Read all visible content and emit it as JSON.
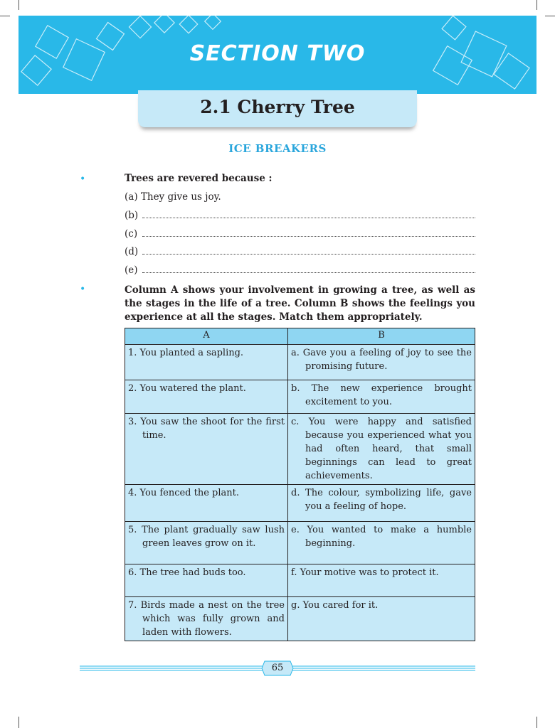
{
  "section_title": "SECTION TWO",
  "chapter_title": "2.1  Cherry  Tree",
  "subheading": "ICE  BREAKERS",
  "question1": {
    "text": "Trees  are  revered  because :",
    "options": [
      "(a)  They  give  us  joy.",
      "(b)",
      "(c)",
      "(d)",
      "(e)"
    ]
  },
  "question2": {
    "text": "Column A shows your involvement in growing a tree, as well as the stages in the life of a tree. Column B shows the feelings you experience at all the stages. Match them appropriately."
  },
  "table": {
    "headers": [
      "A",
      "B"
    ],
    "rows": [
      [
        "1. You planted a sapling.",
        "a. Gave you a feeling of joy to see the promising future."
      ],
      [
        "2. You watered the plant.",
        "b. The new experience brought excitement to you."
      ],
      [
        "3. You saw the shoot for the first time.",
        "c. You were happy and satisfied because you experienced what you had often heard, that small beginnings can lead to great achievements."
      ],
      [
        "4. You fenced the plant.",
        "d. The colour, symbolizing life, gave you a feeling of hope."
      ],
      [
        "5. The plant gradually saw lush green leaves grow on it.",
        "e. You wanted to make a humble beginning."
      ],
      [
        "6. The tree had buds too.",
        "f. Your motive was to protect it."
      ],
      [
        "7. Birds made a nest on the tree which was fully grown and laden with flowers.",
        "g. You cared for it."
      ]
    ]
  },
  "page_number": "65",
  "colors": {
    "banner": "#29b8e8",
    "chapter_box": "#c6e9f8",
    "table_header": "#8fd6f2",
    "table_cell": "#c6e9f8",
    "subheading": "#2aa6dc"
  }
}
